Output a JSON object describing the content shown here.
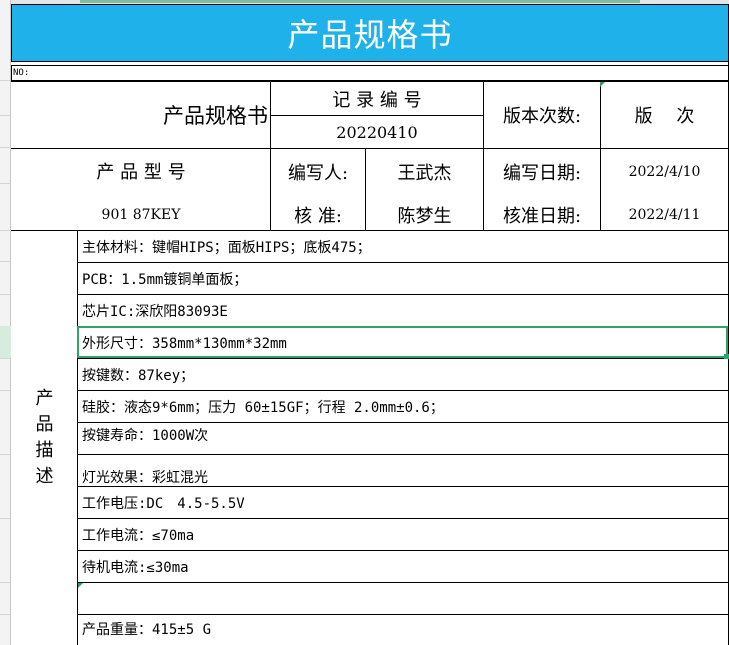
{
  "banner": {
    "title": "产品规格书"
  },
  "no_label": "NO:",
  "header": {
    "spec_title": "产品规格书",
    "record_label": "记 录 编 号",
    "record_number": "20220410",
    "version_label": "版本次数:",
    "version_value": "版　 次",
    "model_label": "产 品 型 号",
    "model_value": "901 87KEY",
    "writer_label": "编写人:",
    "writer_value": "王武杰",
    "write_date_label": "编写日期:",
    "write_date_value": "2022/4/10",
    "approver_label": "核 准:",
    "approver_value": "陈梦生",
    "approve_date_label": "核准日期:",
    "approve_date_value": "2022/4/11"
  },
  "description": {
    "label": "产\n品\n描\n述",
    "lines": [
      "主体材料：键帽HIPS；面板HIPS；底板475；",
      "PCB：1.5mm镀铜单面板；",
      "芯片IC:深欣阳83093E",
      "外形尺寸：358mm*130mm*32mm",
      "按键数：87key；",
      "硅胶：液态9*6mm；压力 60±15GF；行程 2.0mm±0.6；",
      "按键寿命：1000W次",
      "灯光效果：彩虹混光",
      "工作电压:DC　4.5-5.5V",
      "工作电流：≤70ma",
      "待机电流:≤30ma",
      "",
      "产品重量：415±5 G"
    ]
  }
}
